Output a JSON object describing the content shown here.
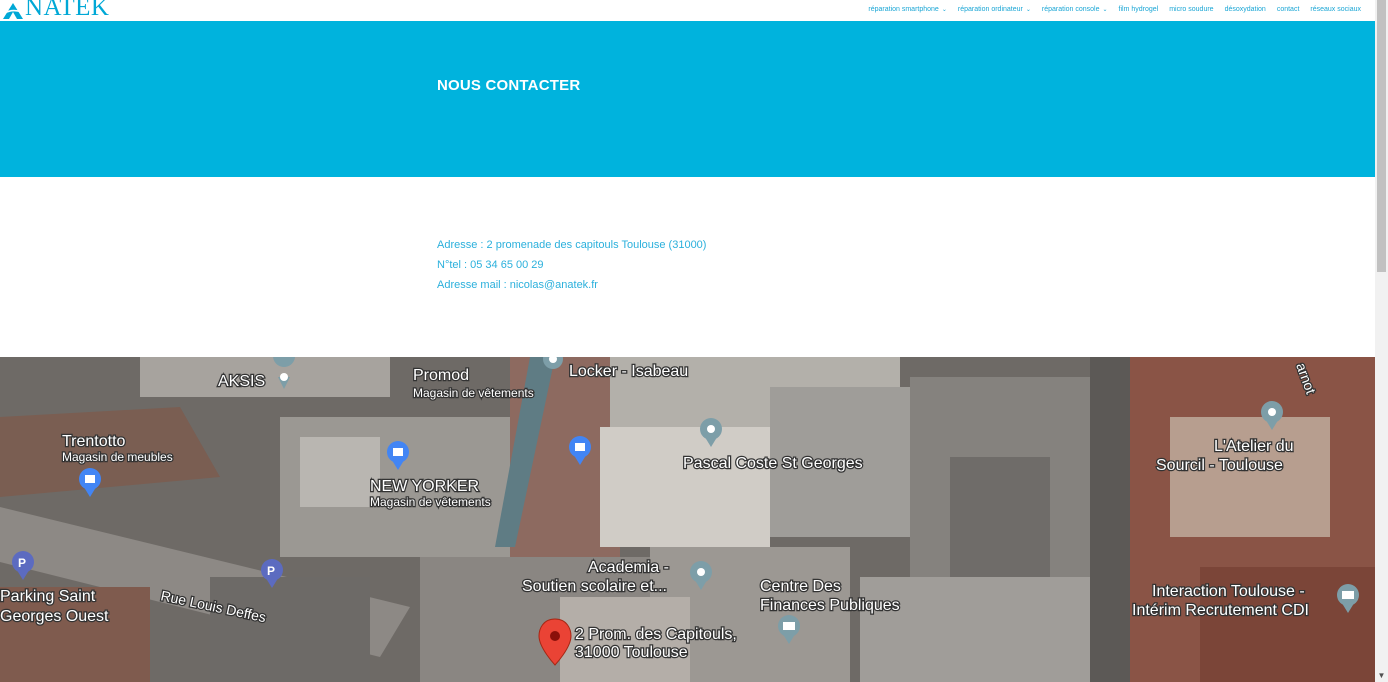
{
  "header": {
    "logo_text": "NATEK",
    "nav": [
      {
        "label": "réparation smartphone",
        "dropdown": true
      },
      {
        "label": "réparation ordinateur",
        "dropdown": true
      },
      {
        "label": "réparation console",
        "dropdown": true
      },
      {
        "label": "film hydrogel",
        "dropdown": false
      },
      {
        "label": "micro soudure",
        "dropdown": false
      },
      {
        "label": "désoxydation",
        "dropdown": false
      },
      {
        "label": "contact",
        "dropdown": false
      },
      {
        "label": "réseaux sociaux",
        "dropdown": false
      }
    ]
  },
  "hero": {
    "title": "NOUS CONTACTER"
  },
  "contact": {
    "address": "Adresse : 2 promenade des capitouls Toulouse (31000)",
    "phone": "N°tel :  05 34 65 00 29",
    "email": "Adresse mail : nicolas@anatek.fr"
  },
  "map": {
    "places": {
      "aksis": "AKSIS",
      "promod": "Promod",
      "promod_sub": "Magasin de vêtements",
      "locker": "Locker - Isabeau",
      "trentotto": "Trentotto",
      "trentotto_sub": "Magasin de meubles",
      "new_yorker": "NEW YORKER",
      "new_yorker_sub": "Magasin de vêtements",
      "pascal": "Pascal Coste St Georges",
      "atelier_1": "L'Atelier du",
      "atelier_2": "Sourcil - Toulouse",
      "parking_1": "Parking Saint",
      "parking_2": "Georges Ouest",
      "rue": "Rue Louis Deffes",
      "academia_1": "Academia -",
      "academia_2": "Soutien scolaire et...",
      "finances_1": "Centre Des",
      "finances_2": "Finances Publiques",
      "interaction_1": "Interaction Toulouse -",
      "interaction_2": "Intérim Recrutement CDI",
      "target_1": "2 Prom. des Capitouls,",
      "target_2": "31000 Toulouse",
      "arnot": "arnot"
    }
  },
  "colors": {
    "brand": "#00b3dd",
    "link": "#2bb0dc",
    "pin": "#ea4335"
  }
}
